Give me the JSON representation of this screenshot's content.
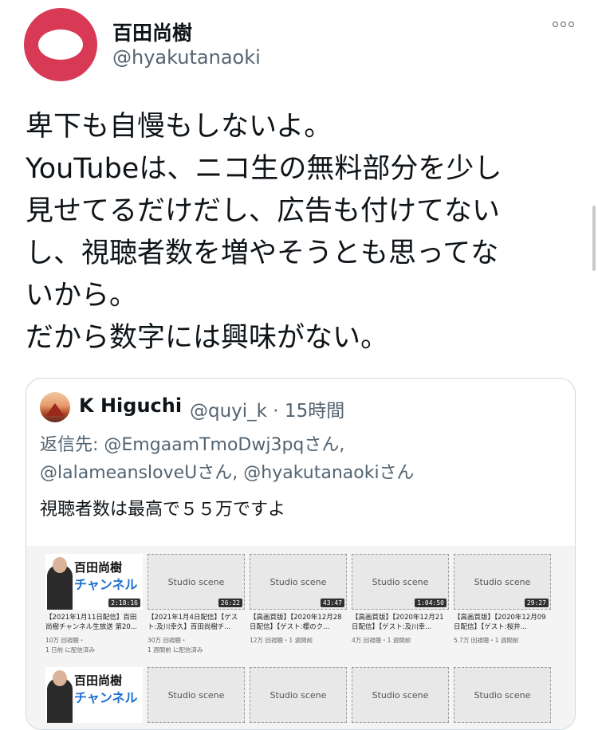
{
  "header": {
    "name": "百田尚樹",
    "handle": "@hyakutanaoki"
  },
  "tweet": {
    "text": "卑下も自慢もしないよ。\nYouTubeは、ニコ生の無料部分を少し\n見せてるだけだし、広告も付けてない\nし、視聴者数を増やそうとも思ってな\nいから。\nだから数字には興味がない。"
  },
  "quote": {
    "name": "K Higuchi",
    "meta": "@quyi_k · 15時間",
    "reply_label": "返信先: ",
    "mentions": [
      "@EmgaamTmoDwj3pqさん,",
      "@lalameansloveUさん,",
      "@hyakutanaokiさん"
    ],
    "text": "視聴者数は最高で５５万ですよ",
    "videos": [
      {
        "duration": "2:18:16",
        "title": "【2021年1月11日配信】百田尚樹チャンネル生放送 第20...",
        "views": "10万 回視聴・",
        "date": "1 日前 に配信済み",
        "card_line1": "百田尚樹",
        "card_line2": "チャンネル"
      },
      {
        "duration": "26:22",
        "title": "【2021年1月4日配信】【ゲスト:及川幸久】百田尚樹チ...",
        "views": "30万 回視聴・",
        "date": "1 週間前 に配信済み"
      },
      {
        "duration": "43:47",
        "title": "【高画質版】【2020年12月28日配信】【ゲスト:櫻のク...",
        "views": "12万 回視聴・1 週間前",
        "date": ""
      },
      {
        "duration": "1:04:50",
        "title": "【高画質版】【2020年12月21日配信】【ゲスト:及川幸...",
        "views": "4万 回視聴・1 週間前",
        "date": ""
      },
      {
        "duration": "29:27",
        "title": "【高画質版】【2020年12月09日配信】【ゲスト:桜井...",
        "views": "5.7万 回視聴・1 週間前",
        "date": ""
      }
    ],
    "second_row": {
      "card_line1": "百田尚樹",
      "card_line2": "チャンネル"
    }
  },
  "colors": {
    "avatar": "#d83a56",
    "secondary_text": "#536471",
    "border": "#cfd9de",
    "brand_blue": "#1d6fd0"
  }
}
